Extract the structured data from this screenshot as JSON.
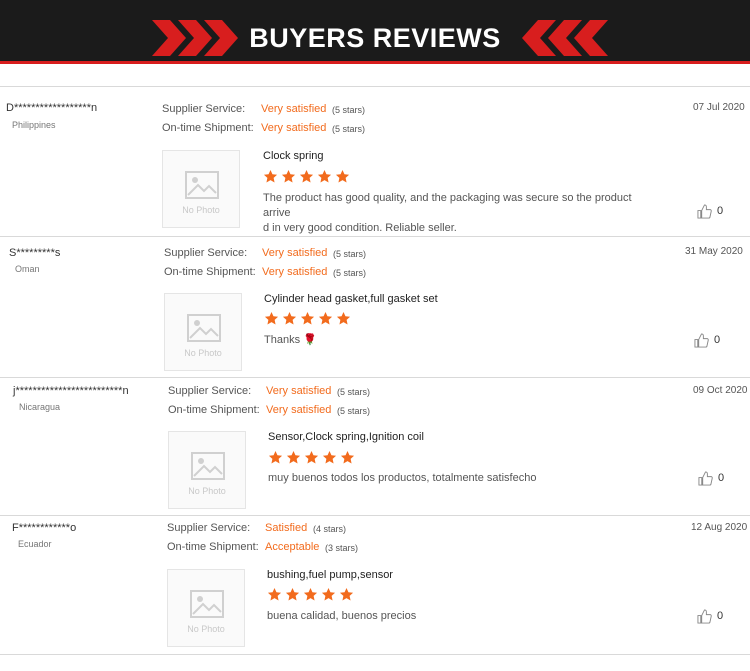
{
  "header": {
    "title": "BUYERS REVIEWS"
  },
  "labels": {
    "supplier_service": "Supplier Service:",
    "ontime_shipment": "On-time Shipment:",
    "no_photo": "No Photo"
  },
  "reviews": [
    {
      "buyer": "D******************n",
      "country": "Philippines",
      "date": "07 Jul 2020",
      "supplier_value": "Very satisfied",
      "supplier_stars": "(5 stars)",
      "shipment_value": "Very satisfied",
      "shipment_stars": "(5 stars)",
      "product": "Clock spring",
      "rating": 5,
      "comment": "The product has good quality, and the packaging was secure so the product arrive\nd in very good condition. Reliable seller.",
      "likes": "0"
    },
    {
      "buyer": "S*********s",
      "country": "Oman",
      "date": "31 May 2020",
      "supplier_value": "Very satisfied",
      "supplier_stars": "(5 stars)",
      "shipment_value": "Very satisfied",
      "shipment_stars": "(5 stars)",
      "product": "Cylinder head gasket,full gasket set",
      "rating": 5,
      "comment": "Thanks 🌹",
      "likes": "0"
    },
    {
      "buyer": "j*************************n",
      "country": "Nicaragua",
      "date": "09 Oct 2020",
      "supplier_value": "Very satisfied",
      "supplier_stars": "(5 stars)",
      "shipment_value": "Very satisfied",
      "shipment_stars": "(5 stars)",
      "product": "Sensor,Clock spring,Ignition coil",
      "rating": 5,
      "comment": "muy buenos todos los productos, totalmente satisfecho",
      "likes": "0"
    },
    {
      "buyer": "F************o",
      "country": "Ecuador",
      "date": "12 Aug 2020",
      "supplier_value": "Satisfied",
      "supplier_stars": "(4 stars)",
      "shipment_value": "Acceptable",
      "shipment_stars": "(3 stars)",
      "product": "bushing,fuel pump,sensor",
      "rating": 5,
      "comment": "buena calidad, buenos precios",
      "likes": "0"
    }
  ],
  "colors": {
    "accent": "#f26b1d",
    "banner_bg": "#1b1b1b",
    "banner_red": "#d81e1e"
  },
  "icons": {
    "photo": "image-placeholder-icon",
    "like": "thumbs-up-icon",
    "star": "star-icon",
    "chevrons": "double-chevron-icon"
  }
}
